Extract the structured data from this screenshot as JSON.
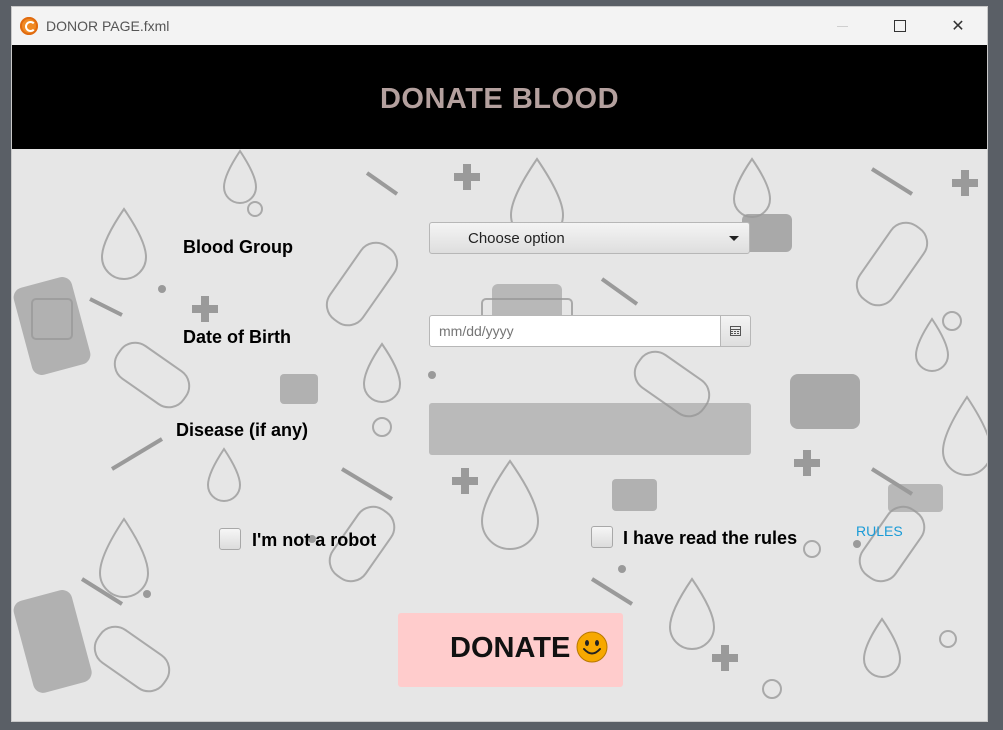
{
  "window": {
    "title": "DONOR PAGE.fxml",
    "controls": {
      "minimize": "minimize-icon",
      "maximize": "maximize-icon",
      "close": "✕"
    }
  },
  "header": {
    "title": "DONATE BLOOD",
    "background": "#000000",
    "title_color": "#b4a09e"
  },
  "form": {
    "blood_group": {
      "label": "Blood Group",
      "selected": "Choose option"
    },
    "date_of_birth": {
      "label": "Date of Birth",
      "placeholder": "mm/dd/yyyy",
      "icon": "calendar-icon"
    },
    "disease": {
      "label": "Disease (if any)",
      "value": ""
    },
    "robot_check": {
      "label": "I'm not a robot",
      "checked": false
    },
    "rules_check": {
      "label": "I have read the rules",
      "checked": false
    },
    "rules_link": "RULES"
  },
  "donate_button": {
    "label": "DONATE",
    "icon": "smiley-icon",
    "background": "#ffcccc"
  },
  "colors": {
    "link": "#1a9bd7",
    "smiley": "#f7a800"
  }
}
